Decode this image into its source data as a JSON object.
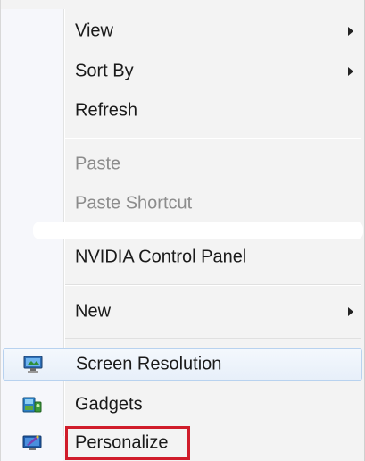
{
  "menu": {
    "items": [
      {
        "label": "View",
        "submenu": true
      },
      {
        "label": "Sort By",
        "submenu": true
      },
      {
        "label": "Refresh"
      },
      {
        "label": "Paste",
        "disabled": true
      },
      {
        "label": "Paste Shortcut",
        "disabled": true
      },
      {
        "label": "NVIDIA Control Panel"
      },
      {
        "label": "New",
        "submenu": true
      },
      {
        "label": "Screen Resolution",
        "icon": "screen-resolution-icon",
        "hovered": true
      },
      {
        "label": "Gadgets",
        "icon": "gadgets-icon"
      },
      {
        "label": "Personalize",
        "icon": "personalize-icon",
        "highlighted": true
      }
    ]
  },
  "colors": {
    "highlight_box": "#d01c2a",
    "hover_border": "#b8d2ef",
    "disabled_text": "#8c8c8c"
  }
}
